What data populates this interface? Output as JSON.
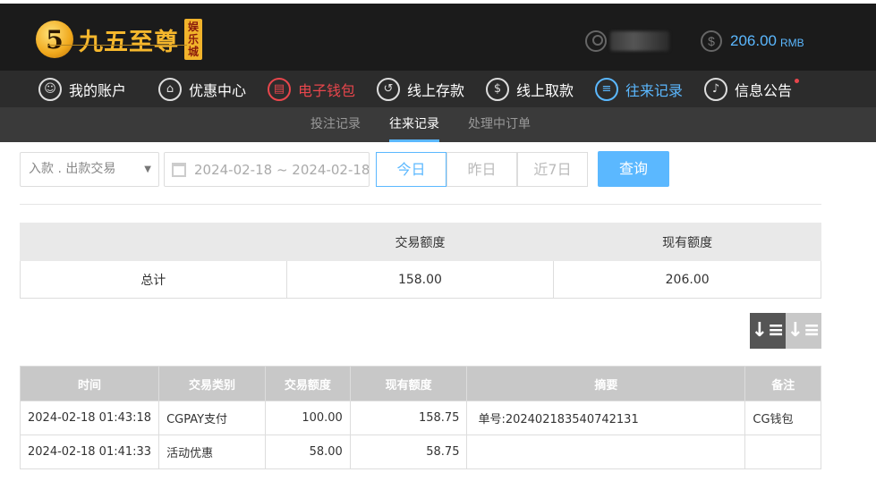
{
  "header": {
    "logo_glyph": "5",
    "logo_text": "九五至尊",
    "logo_sub": "娱乐城",
    "balance_icon": "$",
    "balance": "206.00",
    "currency": "RMB"
  },
  "nav": [
    {
      "label": "我的账户",
      "icon": "user-icon",
      "glyph": "☺",
      "state": "normal"
    },
    {
      "label": "优惠中心",
      "icon": "gift-icon",
      "glyph": "⌂",
      "state": "normal"
    },
    {
      "label": "电子钱包",
      "icon": "wallet-icon",
      "glyph": "▤",
      "state": "red"
    },
    {
      "label": "线上存款",
      "icon": "deposit-icon",
      "glyph": "↺",
      "state": "normal"
    },
    {
      "label": "线上取款",
      "icon": "withdraw-icon",
      "glyph": "$",
      "state": "normal"
    },
    {
      "label": "往来记录",
      "icon": "records-icon",
      "glyph": "≡",
      "state": "active"
    },
    {
      "label": "信息公告",
      "icon": "bell-icon",
      "glyph": "♪",
      "state": "normal"
    }
  ],
  "subnav": [
    {
      "label": "投注记录",
      "active": false
    },
    {
      "label": "往来记录",
      "active": true
    },
    {
      "label": "处理中订单",
      "active": false
    }
  ],
  "filter": {
    "type_select": "入款 . 出款交易",
    "date_range": "2024-02-18 ~ 2024-02-18",
    "quick_ranges": [
      "今日",
      "昨日",
      "近7日"
    ],
    "active_range": "今日",
    "query_label": "查询"
  },
  "summary": {
    "headers": [
      "",
      "交易额度",
      "现有额度"
    ],
    "row": [
      "总计",
      "158.00",
      "206.00"
    ]
  },
  "records": {
    "headers": [
      "时间",
      "交易类别",
      "交易额度",
      "现有额度",
      "摘要",
      "备注"
    ],
    "rows": [
      [
        "2024-02-18 01:43:18",
        "CGPAY支付",
        "100.00",
        "158.75",
        "单号:202402183540742131",
        "CG钱包"
      ],
      [
        "2024-02-18 01:41:33",
        "活动优惠",
        "58.00",
        "58.75",
        "",
        ""
      ]
    ]
  },
  "colors": {
    "accent": "#5bb8ff",
    "alert": "#e8464c",
    "brand_gold": "#f5b72d"
  }
}
